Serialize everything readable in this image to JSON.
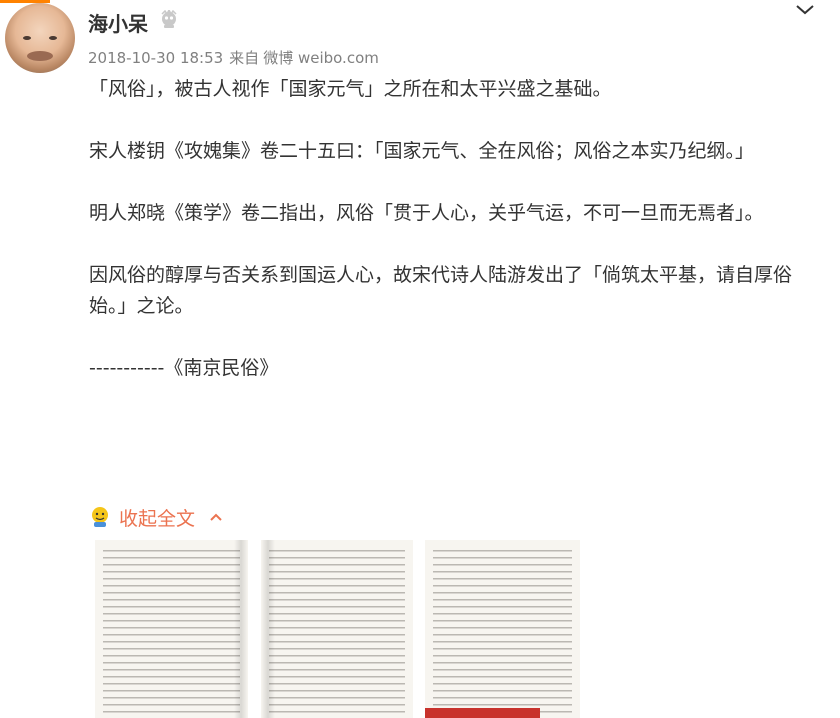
{
  "post": {
    "username": "海小呆",
    "timestamp": "2018-10-30 18:53",
    "source_prefix": "来自",
    "source": "微博 weibo.com",
    "paragraphs": [
      "「风俗」，被古人视作「国家元气」之所在和太平兴盛之基础。",
      "宋人楼钥《攻媿集》卷二十五曰：「国家元气、全在风俗；风俗之本实乃纪纲。」",
      "明人郑晓《策学》卷二指出，风俗「贯于人心，关乎气运，不可一旦而无焉者」。",
      "因风俗的醇厚与否关系到国运人心，故宋代诗人陆游发出了「倘筑太平基，请自厚俗始。」之论。",
      "-----------《南京民俗》"
    ],
    "collapse_label": "收起全文"
  },
  "colors": {
    "accent": "#eb7350",
    "topbar": "#ff8200",
    "meta_text": "#808080",
    "body_text": "#333333"
  },
  "icons": {
    "vip": "vip-badge-icon",
    "menu": "chevron-down-icon",
    "collapse": "emoji-face-icon",
    "collapse_arrow": "chevron-up-icon"
  },
  "images": [
    {
      "name": "book-page-1"
    },
    {
      "name": "book-page-2"
    },
    {
      "name": "book-page-3"
    }
  ]
}
